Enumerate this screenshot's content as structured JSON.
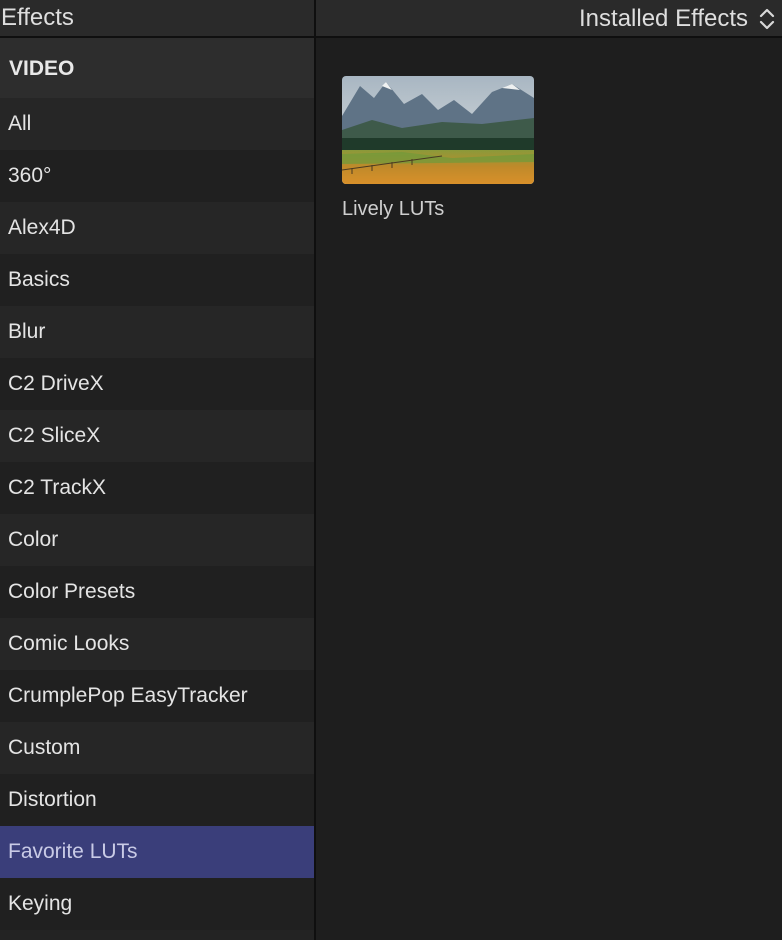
{
  "header": {
    "title": "Effects",
    "selector_label": "Installed Effects"
  },
  "sidebar": {
    "section": "VIDEO",
    "items": [
      {
        "label": "All"
      },
      {
        "label": "360°"
      },
      {
        "label": "Alex4D"
      },
      {
        "label": "Basics"
      },
      {
        "label": "Blur"
      },
      {
        "label": "C2 DriveX"
      },
      {
        "label": "C2 SliceX"
      },
      {
        "label": "C2 TrackX"
      },
      {
        "label": "Color"
      },
      {
        "label": "Color Presets"
      },
      {
        "label": "Comic Looks"
      },
      {
        "label": "CrumplePop EasyTracker"
      },
      {
        "label": "Custom"
      },
      {
        "label": "Distortion"
      },
      {
        "label": "Favorite LUTs",
        "selected": true
      },
      {
        "label": "Keying"
      }
    ]
  },
  "content": {
    "effects": [
      {
        "label": "Lively LUTs",
        "thumbnail": "mountain-landscape"
      }
    ]
  },
  "colors": {
    "selection": "#3a3e7a",
    "background": "#1e1e1e",
    "sidebar": "#232323"
  }
}
